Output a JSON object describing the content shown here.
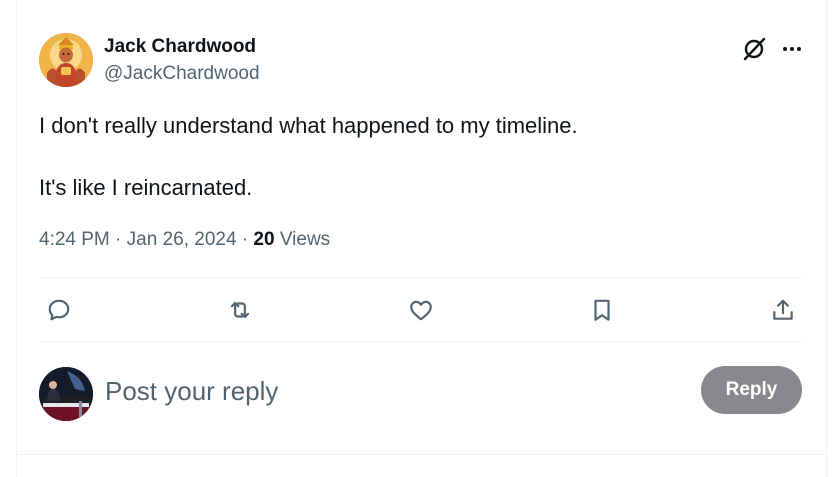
{
  "tweet": {
    "author": {
      "name": "Jack Chardwood",
      "handle": "@JackChardwood",
      "avatar": "deity-portrait-avatar"
    },
    "text": "I don't really understand what happened to my timeline.\n\nIt's like I reincarnated.",
    "meta": {
      "time": "4:24 PM",
      "separator": " · ",
      "date": "Jan 26, 2024",
      "views_count": "20",
      "views_label": " Views"
    },
    "actions": [
      {
        "name": "reply",
        "icon": "reply-icon"
      },
      {
        "name": "retweet",
        "icon": "retweet-icon"
      },
      {
        "name": "like",
        "icon": "heart-icon"
      },
      {
        "name": "bookmark",
        "icon": "bookmark-icon"
      },
      {
        "name": "share",
        "icon": "share-icon"
      }
    ],
    "header_icons": [
      "grok-icon",
      "more-icon"
    ]
  },
  "reply_box": {
    "placeholder": "Post your reply",
    "button_label": "Reply",
    "avatar": "pianist-avatar"
  },
  "colors": {
    "text_primary": "#0f1419",
    "text_secondary": "#536471",
    "divider": "#eff3f4",
    "reply_button_disabled": "#87898c"
  }
}
